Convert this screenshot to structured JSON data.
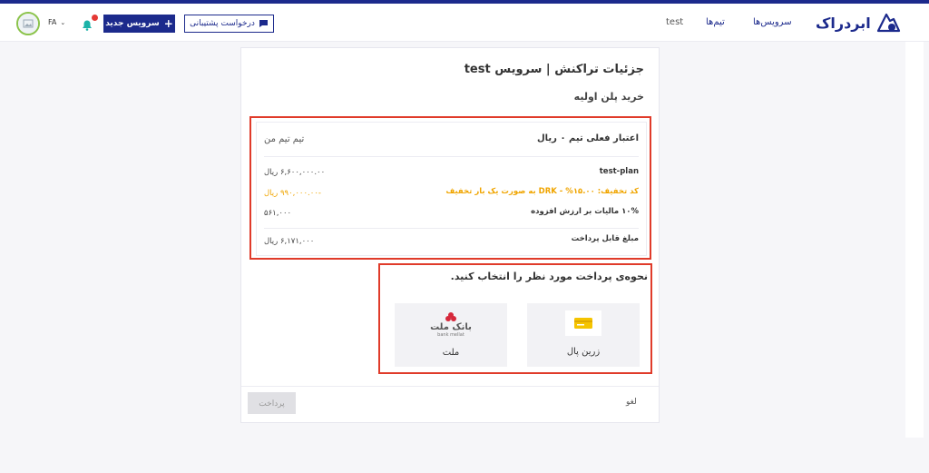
{
  "header": {
    "logo_text": "ابردراک",
    "nav": {
      "services": "سرویس‌ها",
      "teams": "تیم‌ها",
      "test": "test"
    },
    "support_button": "درخواست پشتیبانی",
    "new_service_button": "سرویس جدید",
    "lang": "FA"
  },
  "page": {
    "title": "جزئیات تراکنش | سرویس test",
    "subtitle": "خرید پلن اولیه"
  },
  "summary": {
    "credit_label": "اعتبار فعلی تیم ۰ ریال",
    "team_name": "تیم تیم من",
    "rows": [
      {
        "label": "test-plan",
        "value": "۶,۶۰۰,۰۰۰.۰۰ ریال"
      },
      {
        "label": "کد تخفیف: ۱۵.۰۰% - DRK به صورت یک بار تخفیف",
        "value": "-۹۹۰,۰۰۰.۰۰ ریال"
      },
      {
        "label": "۱۰% مالیات بر ارزش افزوده",
        "value": "۵۶۱,۰۰۰"
      },
      {
        "label": "مبلغ قابل پرداخت",
        "value": "۶,۱۷۱,۰۰۰ ریال"
      }
    ]
  },
  "payment": {
    "title": "نحوه‌ی پرداخت مورد نظر را انتخاب کنید.",
    "gateways": [
      {
        "label": "زرین پال"
      },
      {
        "label": "ملت",
        "logo_text": "بانک ملت",
        "logo_sub": "bank mellat"
      }
    ]
  },
  "footer": {
    "cancel": "لغو",
    "pay": "پرداخت"
  },
  "colors": {
    "brand": "#1c2a8c",
    "highlight": "#e03b2a",
    "discount": "#f0a500"
  }
}
